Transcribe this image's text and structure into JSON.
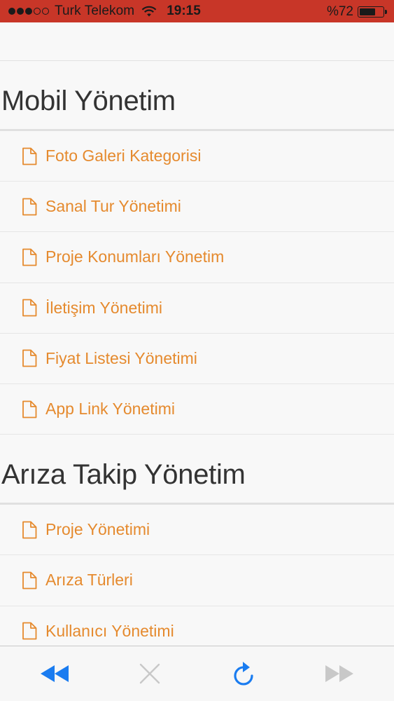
{
  "status_bar": {
    "carrier": "Turk Telekom",
    "time": "19:15",
    "battery_text": "%72",
    "battery_level": 0.72,
    "signal_bars_filled": 3,
    "signal_bars_total": 5,
    "background_color": "#c83628"
  },
  "sections": [
    {
      "title": "Mobil Yönetim",
      "items": [
        {
          "label": "Foto Galeri Kategorisi",
          "icon": "document-icon"
        },
        {
          "label": "Sanal Tur Yönetimi",
          "icon": "document-icon"
        },
        {
          "label": "Proje Konumları Yönetim",
          "icon": "document-icon"
        },
        {
          "label": "İletişim Yönetimi",
          "icon": "document-icon"
        },
        {
          "label": "Fiyat Listesi Yönetimi",
          "icon": "document-icon"
        },
        {
          "label": "App Link Yönetimi",
          "icon": "document-icon"
        }
      ]
    },
    {
      "title": "Arıza Takip Yönetim",
      "items": [
        {
          "label": "Proje Yönetimi",
          "icon": "document-icon"
        },
        {
          "label": "Arıza Türleri",
          "icon": "document-icon"
        },
        {
          "label": "Kullanıcı Yönetimi",
          "icon": "document-icon"
        }
      ]
    }
  ],
  "toolbar": {
    "back": {
      "icon": "rewind-icon",
      "enabled": true
    },
    "stop": {
      "icon": "close-icon",
      "enabled": false
    },
    "reload": {
      "icon": "refresh-icon",
      "enabled": true
    },
    "forward": {
      "icon": "fast-forward-icon",
      "enabled": false
    }
  },
  "colors": {
    "link": "#e58a2e",
    "heading": "#333333",
    "toolbar_active": "#1a7cf0",
    "toolbar_disabled": "#c8c8c8"
  }
}
